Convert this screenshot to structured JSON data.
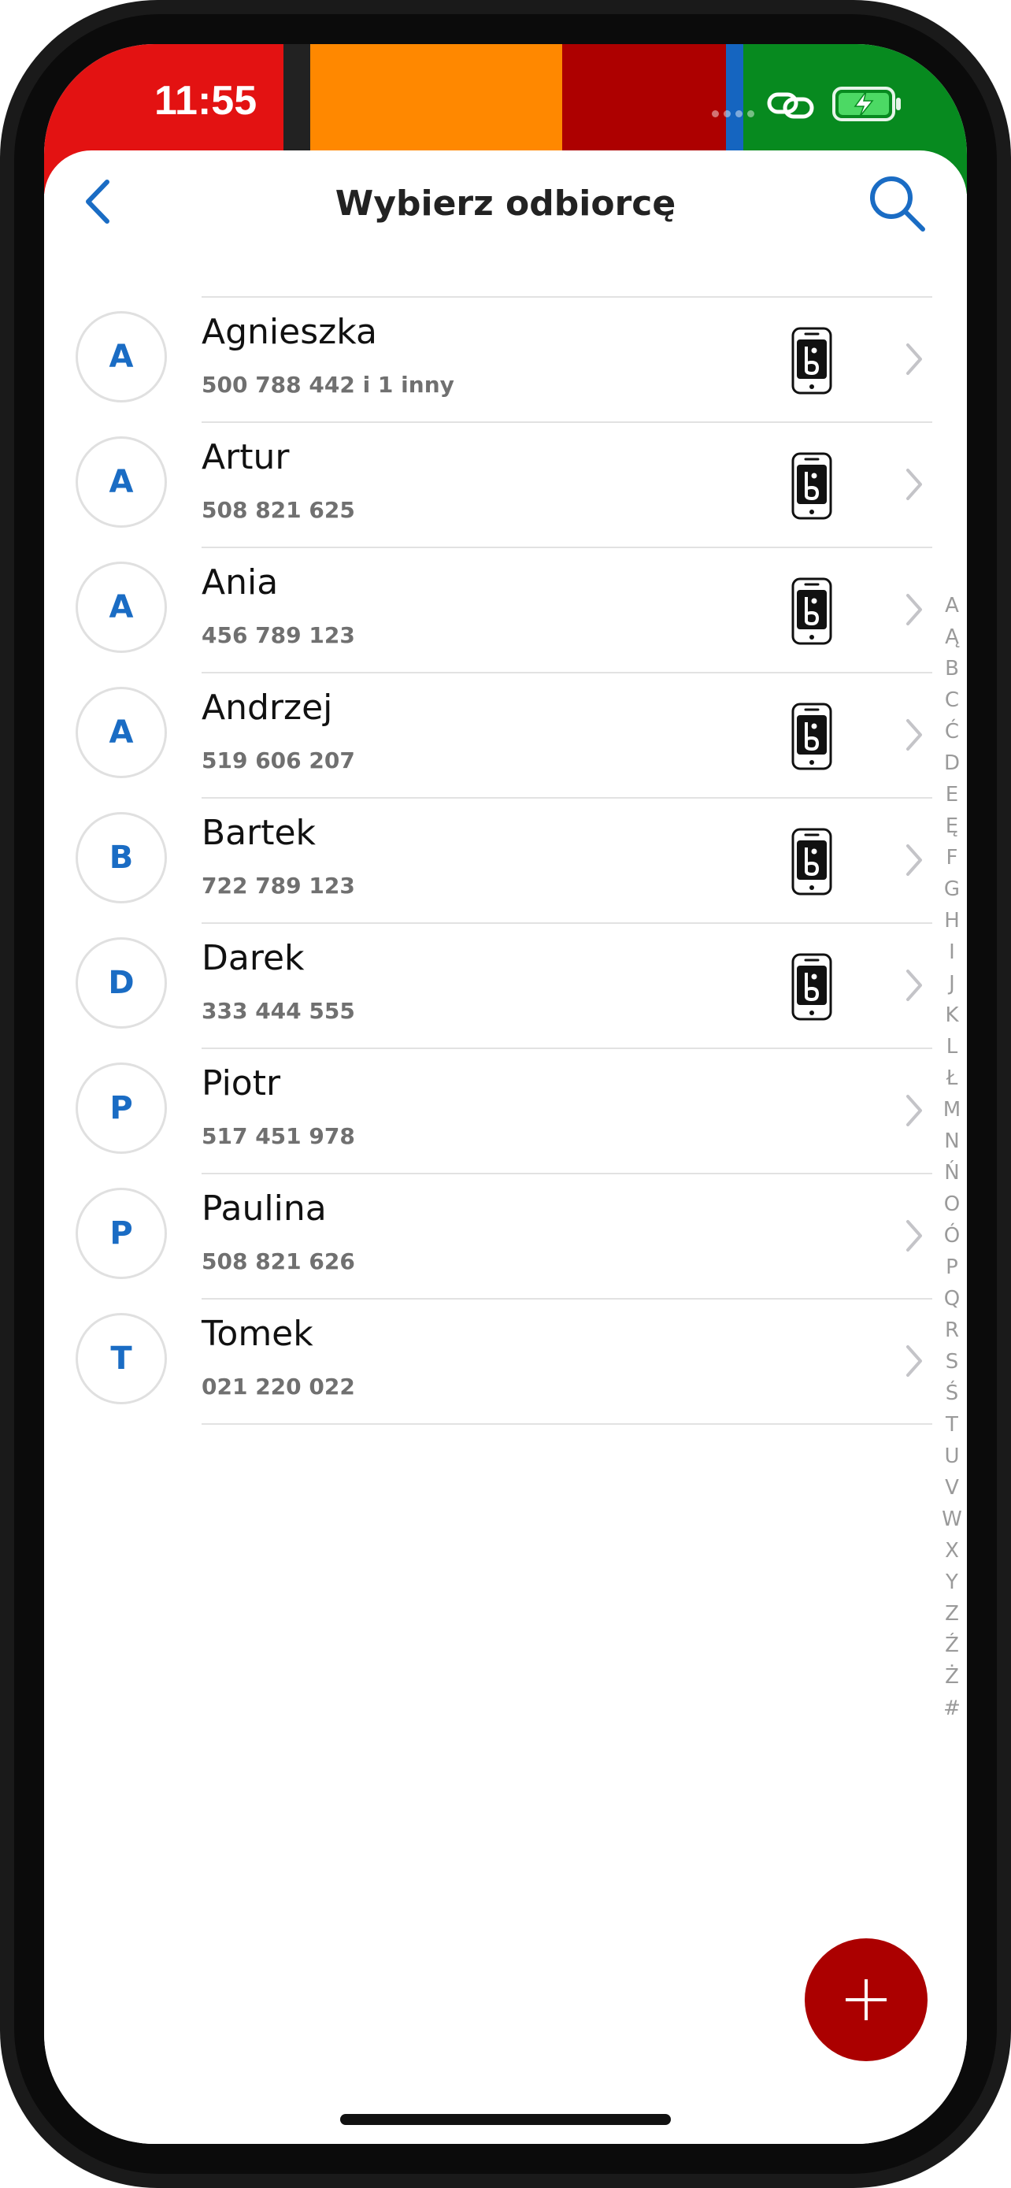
{
  "status_bar": {
    "time": "11:55",
    "colors": [
      "#e31212",
      "#222222",
      "#ff8800",
      "#ad0000",
      "#1565c0",
      "#078a1f"
    ],
    "icons": [
      "link-icon",
      "battery-charging-icon"
    ]
  },
  "header": {
    "title": "Wybierz odbiorcę",
    "back_icon": "chevron-left-icon",
    "search_icon": "search-icon"
  },
  "contacts": [
    {
      "initial": "A",
      "name": "Agnieszka",
      "number": "500 788 442 i 1 inny",
      "app_icon": true
    },
    {
      "initial": "A",
      "name": "Artur",
      "number": "508 821 625",
      "app_icon": true
    },
    {
      "initial": "A",
      "name": "Ania",
      "number": "456 789 123",
      "app_icon": true
    },
    {
      "initial": "A",
      "name": "Andrzej",
      "number": "519 606 207",
      "app_icon": true
    },
    {
      "initial": "B",
      "name": "Bartek",
      "number": "722 789 123",
      "app_icon": true
    },
    {
      "initial": "D",
      "name": "Darek",
      "number": "333 444 555",
      "app_icon": true
    },
    {
      "initial": "P",
      "name": "Piotr",
      "number": "517 451 978",
      "app_icon": false
    },
    {
      "initial": "P",
      "name": "Paulina",
      "number": "508 821 626",
      "app_icon": false
    },
    {
      "initial": "T",
      "name": "Tomek",
      "number": "021 220 022",
      "app_icon": false
    }
  ],
  "alphabet_index": [
    "A",
    "Ą",
    "B",
    "C",
    "Ć",
    "D",
    "E",
    "Ę",
    "F",
    "G",
    "H",
    "I",
    "J",
    "K",
    "L",
    "Ł",
    "M",
    "N",
    "Ń",
    "O",
    "Ó",
    "P",
    "Q",
    "R",
    "S",
    "Ś",
    "T",
    "U",
    "V",
    "W",
    "X",
    "Y",
    "Z",
    "Ź",
    "Ż",
    "#"
  ],
  "fab": {
    "icon": "plus-icon",
    "color": "#ab0000"
  },
  "accent_color": "#1a6cc4"
}
